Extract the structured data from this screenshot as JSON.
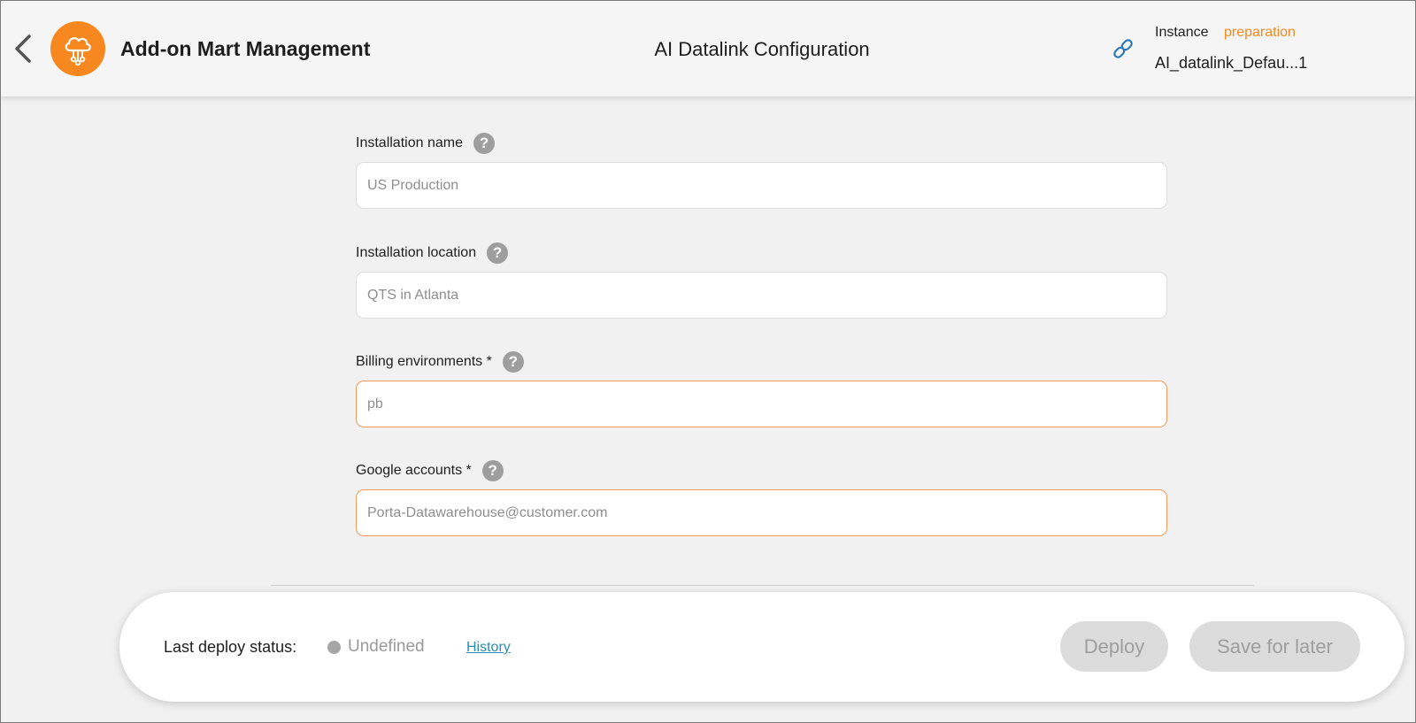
{
  "header": {
    "app_title": "Add-on Mart Management",
    "page_title": "AI Datalink Configuration",
    "instance_label": "Instance",
    "instance_status": "preparation",
    "instance_name": "AI_datalink_Defau...1",
    "accent_color": "#f7881f"
  },
  "form": {
    "fields": [
      {
        "label": "Installation name",
        "value": "US Production",
        "required": false
      },
      {
        "label": "Installation location",
        "value": "QTS in Atlanta",
        "required": false
      },
      {
        "label": "Billing environments *",
        "value": "pb",
        "required": true
      },
      {
        "label": "Google accounts *",
        "value": "Porta-Datawarehouse@customer.com",
        "required": true
      }
    ]
  },
  "footer": {
    "deploy_status_label": "Last deploy status:",
    "deploy_status_value": "Undefined",
    "history_link": "History",
    "deploy_button": "Deploy",
    "save_button": "Save for later"
  },
  "icons": {
    "back": "chevron-left-icon",
    "logo": "cloud-network-icon",
    "link": "link-icon",
    "help": "question-mark-icon"
  }
}
